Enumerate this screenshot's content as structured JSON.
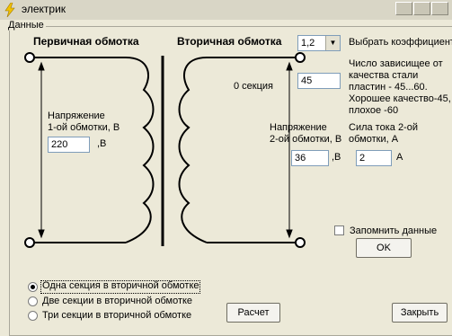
{
  "window": {
    "title": "электрик"
  },
  "group": {
    "label": "Данные"
  },
  "diagram": {
    "primary_title": "Первичная обмотка",
    "secondary_title": "Вторичная обмотка",
    "section_label": "0 секция"
  },
  "primary": {
    "voltage_label_1": "Напряжение",
    "voltage_label_2": "1-ой обмотки, В",
    "voltage_value": "220",
    "voltage_unit": ",В"
  },
  "coef": {
    "selected": "1,2",
    "label": "Выбрать коэффициент",
    "desc_1": "Число зависищее от",
    "desc_2": "качества стали",
    "desc_3": "пластин - 45...60.",
    "desc_4": "Хорошее качество-45,",
    "desc_5": "плохое -60",
    "value": "45"
  },
  "secondary": {
    "voltage_label_1": "Напряжение",
    "voltage_label_2": "2-ой обмотки, В",
    "voltage_value": "36",
    "voltage_unit": ",В",
    "current_label_1": "Сила тока 2-ой",
    "current_label_2": "обмотки, А",
    "current_value": "2",
    "current_unit": "А"
  },
  "remember": {
    "label": "Запомнить данные",
    "checked": false
  },
  "buttons": {
    "ok": "OK",
    "calc": "Расчет",
    "close": "Закрыть"
  },
  "options": [
    {
      "label": "Одна секция в вторичной обмотке",
      "selected": true
    },
    {
      "label": "Две секции в вторичной обмотке",
      "selected": false
    },
    {
      "label": "Три секции в вторичной обмотке",
      "selected": false
    }
  ]
}
